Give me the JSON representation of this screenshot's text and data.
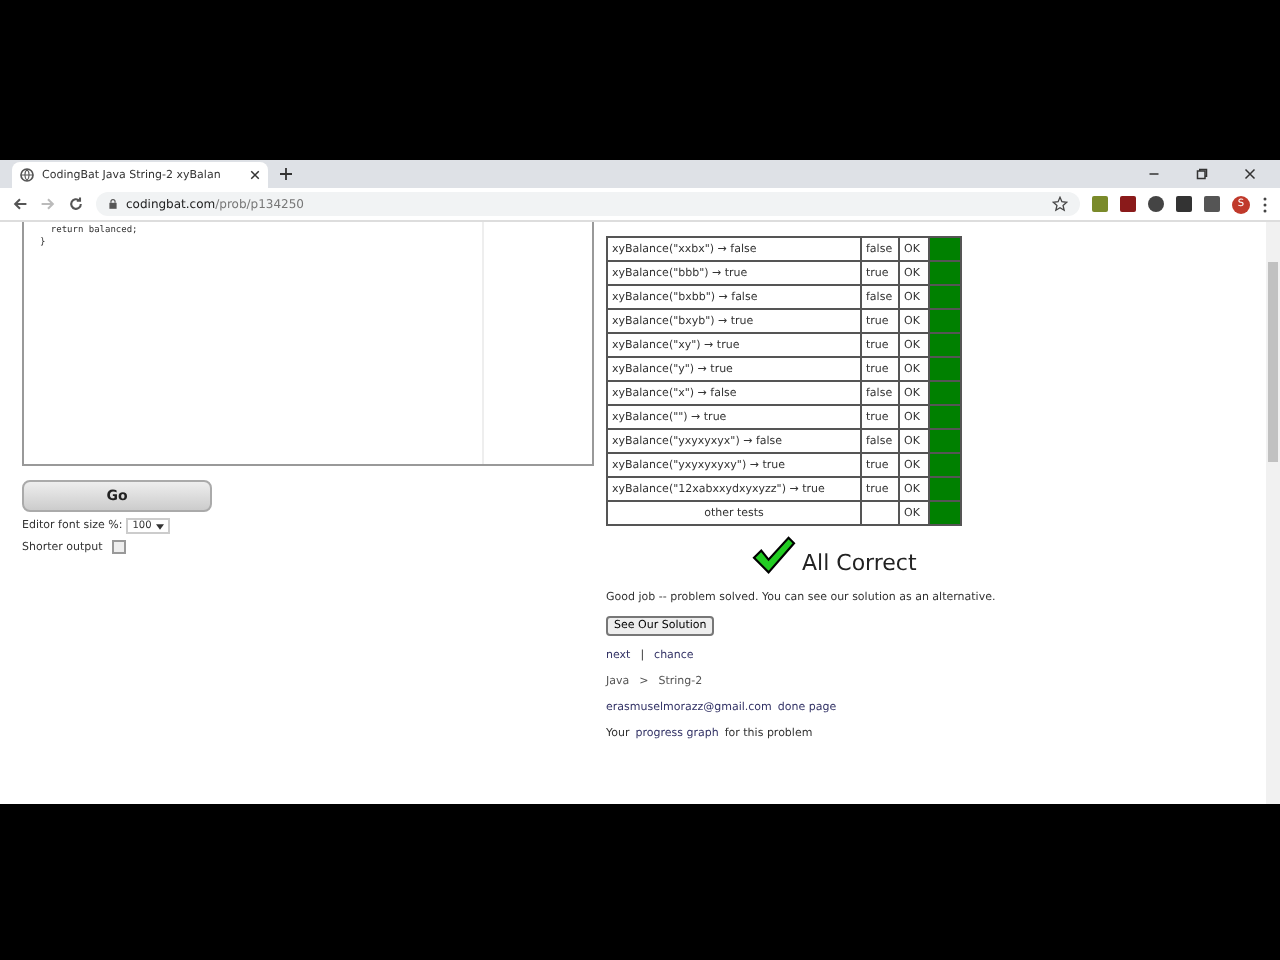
{
  "browser": {
    "tab_title": "CodingBat Java String-2 xyBalan",
    "url_host": "codingbat.com",
    "url_path": "/prob/p134250",
    "avatar_letter": "S"
  },
  "editor": {
    "code_lines": [
      "  return balanced;",
      "}"
    ]
  },
  "go_button": "Go",
  "font_size": {
    "label": "Editor font size %:",
    "value": "100"
  },
  "shorter_output": {
    "label": "Shorter output",
    "checked": false
  },
  "tests": [
    {
      "call": "xyBalance(\"xxbx\") → false",
      "result": "false",
      "status": "OK",
      "passed": true
    },
    {
      "call": "xyBalance(\"bbb\") → true",
      "result": "true",
      "status": "OK",
      "passed": true
    },
    {
      "call": "xyBalance(\"bxbb\") → false",
      "result": "false",
      "status": "OK",
      "passed": true
    },
    {
      "call": "xyBalance(\"bxyb\") → true",
      "result": "true",
      "status": "OK",
      "passed": true
    },
    {
      "call": "xyBalance(\"xy\") → true",
      "result": "true",
      "status": "OK",
      "passed": true
    },
    {
      "call": "xyBalance(\"y\") → true",
      "result": "true",
      "status": "OK",
      "passed": true
    },
    {
      "call": "xyBalance(\"x\") → false",
      "result": "false",
      "status": "OK",
      "passed": true
    },
    {
      "call": "xyBalance(\"\") → true",
      "result": "true",
      "status": "OK",
      "passed": true
    },
    {
      "call": "xyBalance(\"yxyxyxyx\") → false",
      "result": "false",
      "status": "OK",
      "passed": true
    },
    {
      "call": "xyBalance(\"yxyxyxyxy\") → true",
      "result": "true",
      "status": "OK",
      "passed": true
    },
    {
      "call": "xyBalance(\"12xabxxydxyxyzz\") → true",
      "result": "true",
      "status": "OK",
      "passed": true
    },
    {
      "call": "other tests",
      "status": "OK",
      "passed": true
    }
  ],
  "verdict": "All Correct",
  "message": "Good job -- problem solved. You can see our solution as an alternative.",
  "solution_button": "See Our Solution",
  "nav_links": [
    "next",
    "chance"
  ],
  "nav_separator": "|",
  "breadcrumb": {
    "items": [
      "Java",
      "String-2"
    ],
    "separator": ">"
  },
  "account": {
    "email": "erasmuselmorazz@gmail.com",
    "link": "done page"
  },
  "progress": {
    "before": "Your",
    "link": "progress graph",
    "after": "for this problem"
  }
}
